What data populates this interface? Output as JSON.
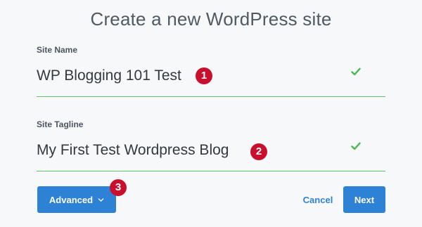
{
  "dialog": {
    "title": "Create a new WordPress site"
  },
  "site_name": {
    "label": "Site Name",
    "value": "WP Blogging 101 Test",
    "status_icon": "check-icon"
  },
  "site_tagline": {
    "label": "Site Tagline",
    "value": "My First Test Wordpress Blog",
    "status_icon": "check-icon"
  },
  "annotations": {
    "badge_1": "1",
    "badge_2": "2",
    "badge_3": "3"
  },
  "actions": {
    "advanced_label": "Advanced",
    "cancel_label": "Cancel",
    "next_label": "Next"
  },
  "colors": {
    "accent": "#2d82d6",
    "success": "#49b853",
    "badge": "#c8102e"
  }
}
